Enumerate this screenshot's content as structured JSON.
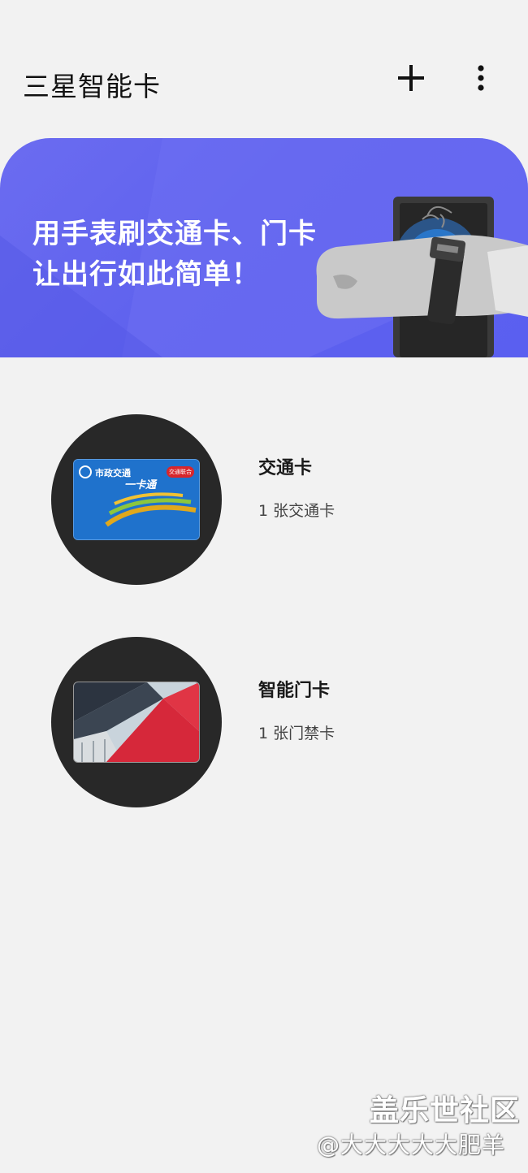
{
  "app_bar": {
    "title": "三星智能卡",
    "add_icon": "plus-icon",
    "more_icon": "more-vert-icon"
  },
  "banner": {
    "line1": "用手表刷交通卡、门卡",
    "line2": "让出行如此简单！",
    "accent_color": "#5f62ee"
  },
  "cards": [
    {
      "title": "交通卡",
      "subtitle": "1 张交通卡",
      "thumbnail_text_left": "市政交通",
      "thumbnail_text_right": "一卡通",
      "thumbnail_badge": "交通联合"
    },
    {
      "title": "智能门卡",
      "subtitle": "1 张门禁卡"
    }
  ],
  "watermark": {
    "line1": "盖乐世社区",
    "line2": "@大大大大大肥羊"
  }
}
